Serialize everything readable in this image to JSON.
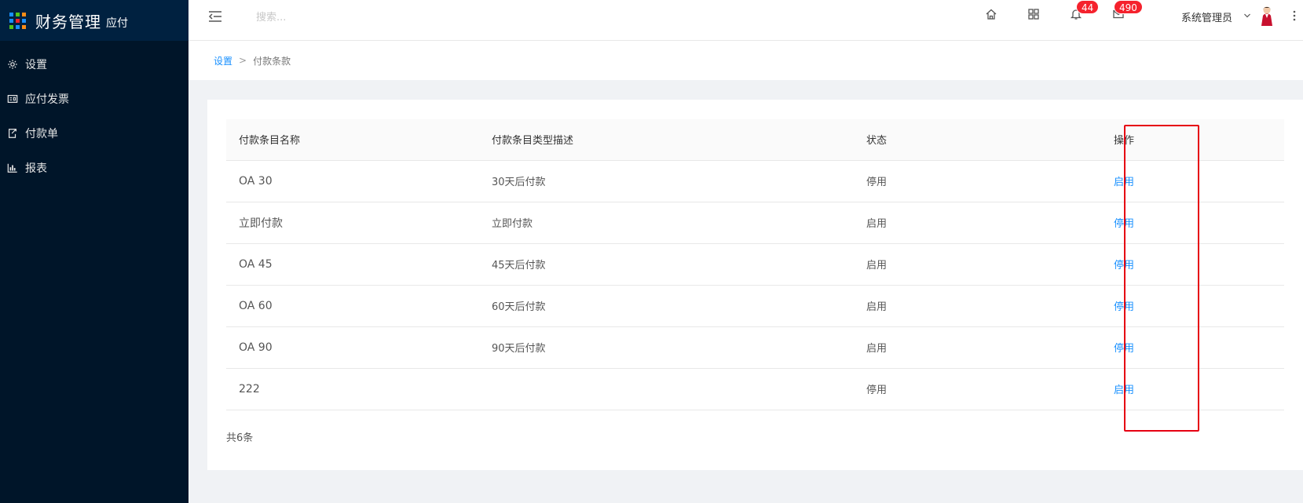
{
  "brand": {
    "title": "财务管理",
    "subtitle": "应付",
    "dot_colors": [
      "#1890ff",
      "#52c41a",
      "#fa8c16",
      "#1890ff",
      "#f5222d",
      "#1890ff",
      "#52c41a",
      "#1890ff",
      "#fa8c16"
    ]
  },
  "sidebar": {
    "items": [
      {
        "label": "设置",
        "icon": "gear-icon"
      },
      {
        "label": "应付发票",
        "icon": "invoice-icon"
      },
      {
        "label": "付款单",
        "icon": "payment-order-icon"
      },
      {
        "label": "报表",
        "icon": "bar-chart-icon"
      }
    ]
  },
  "header": {
    "search_placeholder": "搜索...",
    "notifications_count": "44",
    "messages_count": "490",
    "user_name": "系统管理员"
  },
  "breadcrumb": {
    "parent": "设置",
    "separator": ">",
    "current": "付款条款"
  },
  "table": {
    "columns": [
      "付款条目名称",
      "付款条目类型描述",
      "状态",
      "操作"
    ],
    "rows": [
      {
        "name": "OA 30",
        "desc": "30天后付款",
        "status": "停用",
        "action": "启用"
      },
      {
        "name": "立即付款",
        "desc": "立即付款",
        "status": "启用",
        "action": "停用"
      },
      {
        "name": "OA 45",
        "desc": "45天后付款",
        "status": "启用",
        "action": "停用"
      },
      {
        "name": "OA 60",
        "desc": "60天后付款",
        "status": "启用",
        "action": "停用"
      },
      {
        "name": "OA 90",
        "desc": "90天后付款",
        "status": "启用",
        "action": "停用"
      },
      {
        "name": "222",
        "desc": "",
        "status": "停用",
        "action": "启用"
      }
    ],
    "total": "共6条"
  },
  "colors": {
    "sidebar_bg": "#001529",
    "link": "#1890ff",
    "badge": "#f5222d",
    "highlight": "#e60012"
  }
}
